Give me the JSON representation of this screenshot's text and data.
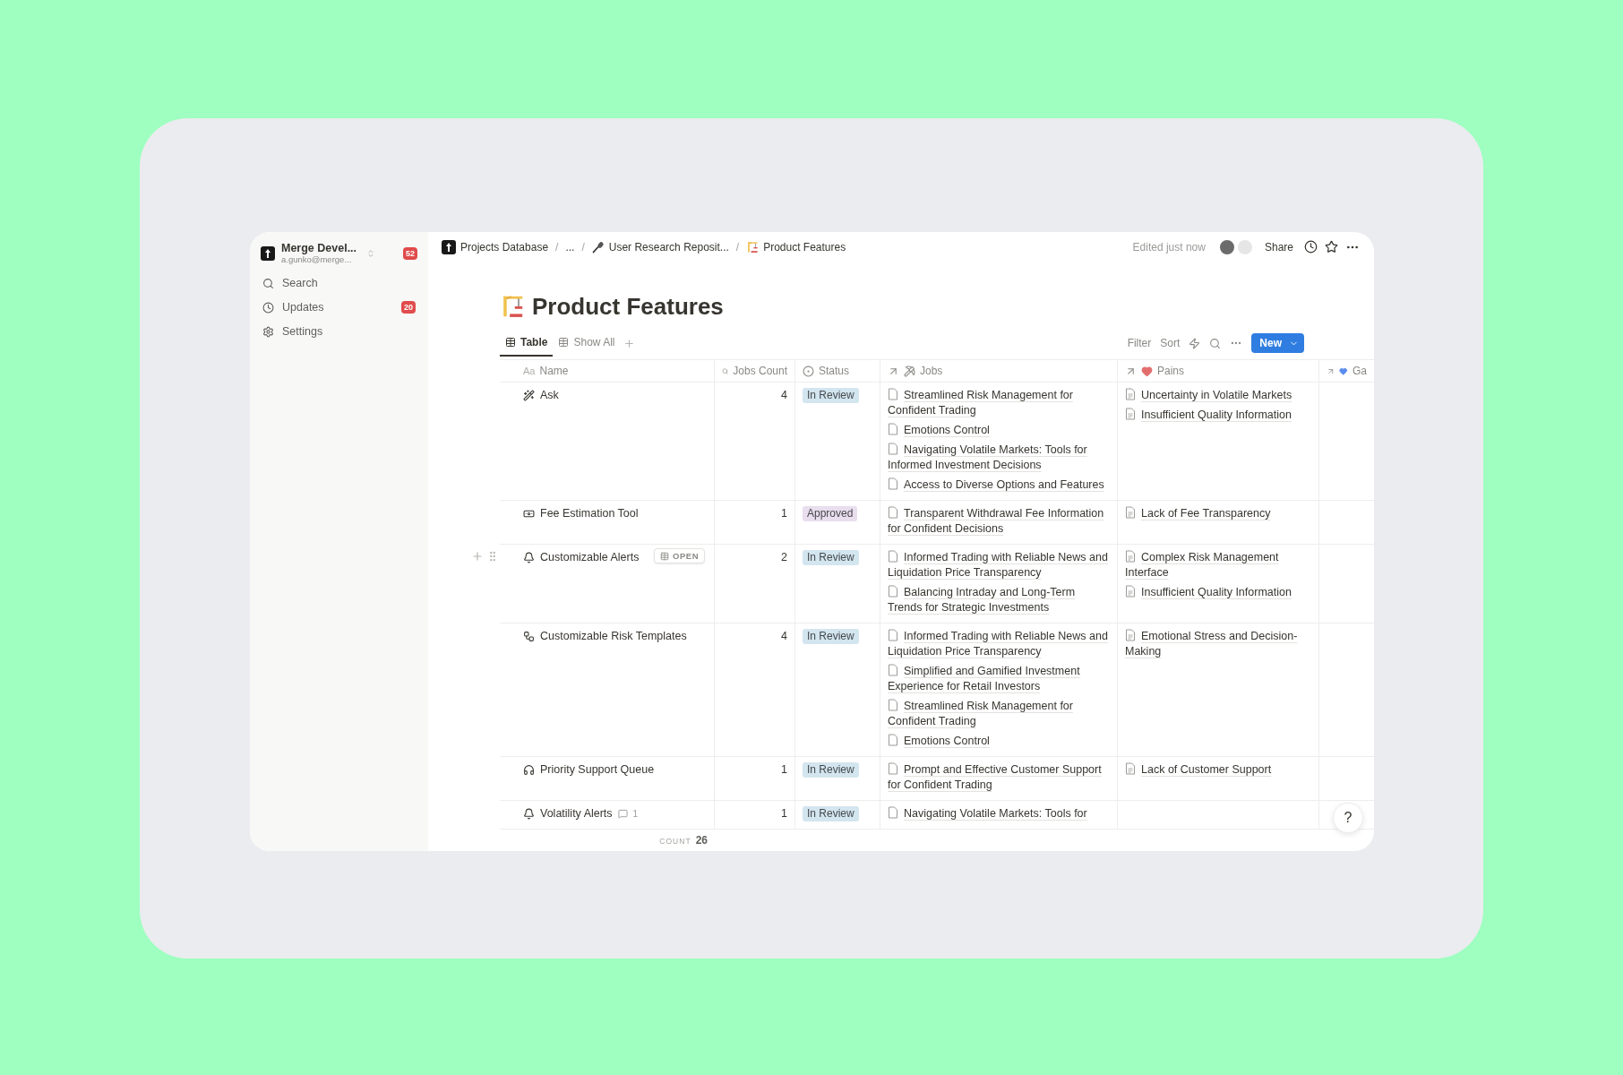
{
  "sidebar": {
    "workspace": {
      "name": "Merge Devel...",
      "email": "a.gunko@merge...",
      "badge": "52"
    },
    "items": [
      {
        "label": "Search"
      },
      {
        "label": "Updates",
        "badge": "20"
      },
      {
        "label": "Settings"
      }
    ]
  },
  "breadcrumbs": [
    {
      "kind": "workspace",
      "label": "Projects Database"
    },
    {
      "kind": "separator",
      "label": "/"
    },
    {
      "kind": "ellipsis",
      "label": "..."
    },
    {
      "kind": "separator",
      "label": "/"
    },
    {
      "kind": "research",
      "label": "User Research Reposit..."
    },
    {
      "kind": "separator",
      "label": "/"
    },
    {
      "kind": "feature",
      "label": "Product Features"
    }
  ],
  "topbar": {
    "edited": "Edited just now",
    "share": "Share"
  },
  "page": {
    "title": "Product Features"
  },
  "views": [
    {
      "label": "Table",
      "selected": true
    },
    {
      "label": "Show All",
      "selected": false
    }
  ],
  "toolbar": {
    "filter": "Filter",
    "sort": "Sort",
    "new_button": "New"
  },
  "table": {
    "columns": [
      {
        "kind": "title",
        "icon_text": "Aa",
        "label": "Name"
      },
      {
        "kind": "number",
        "label": "Jobs Count"
      },
      {
        "kind": "status",
        "label": "Status"
      },
      {
        "kind": "relation",
        "label": "Jobs"
      },
      {
        "kind": "relation",
        "label": "Pains",
        "color": "#e36d6d"
      },
      {
        "kind": "relation",
        "label": "Ga",
        "color": "#5b8def"
      }
    ],
    "rows": [
      {
        "name": "Ask",
        "hovered": false,
        "jobs_count": "4",
        "status": {
          "label": "In Review",
          "color": "#d3e5ef"
        },
        "jobs": [
          "Streamlined Risk Management for Confident Trading",
          "Emotions Control",
          "Navigating Volatile Markets: Tools for Informed Investment Decisions",
          "Access to Diverse Options and Features"
        ],
        "pains": [
          "Uncertainty in Volatile Markets",
          "Insufficient Quality Information"
        ]
      },
      {
        "name": "Fee Estimation Tool",
        "hovered": false,
        "jobs_count": "1",
        "status": {
          "label": "Approved",
          "color": "#e8deee"
        },
        "jobs": [
          "Transparent Withdrawal Fee Information for Confident Decisions"
        ],
        "pains": [
          "Lack of Fee Transparency"
        ]
      },
      {
        "name": "Customizable Alerts",
        "hovered": true,
        "open_label": "OPEN",
        "jobs_count": "2",
        "status": {
          "label": "In Review",
          "color": "#d3e5ef"
        },
        "jobs": [
          "Informed Trading with Reliable News and Liquidation Price Transparency",
          "Balancing Intraday and Long-Term Trends for Strategic Investments"
        ],
        "pains": [
          "Complex Risk Management Interface",
          "Insufficient Quality Information"
        ]
      },
      {
        "name": "Customizable Risk Templates",
        "hovered": false,
        "jobs_count": "4",
        "status": {
          "label": "In Review",
          "color": "#d3e5ef"
        },
        "jobs": [
          "Informed Trading with Reliable News and Liquidation Price Transparency",
          "Simplified and Gamified Investment Experience for Retail Investors",
          "Streamlined Risk Management for Confident Trading",
          "Emotions Control"
        ],
        "pains": [
          "Emotional Stress and Decision-Making"
        ]
      },
      {
        "name": "Priority Support Queue",
        "hovered": false,
        "jobs_count": "1",
        "status": {
          "label": "In Review",
          "color": "#d3e5ef"
        },
        "jobs": [
          "Prompt and Effective Customer Support for Confident Trading"
        ],
        "pains": [
          "Lack of Customer Support"
        ]
      },
      {
        "name": "Volatility Alerts",
        "hovered": false,
        "comment_count": "1",
        "jobs_count": "1",
        "status": {
          "label": "In Review",
          "color": "#d3e5ef"
        },
        "jobs": [
          "Navigating Volatile Markets: Tools for"
        ],
        "pains": []
      }
    ]
  },
  "footer": {
    "count_label": "COUNT",
    "count": "26"
  },
  "help": "?"
}
